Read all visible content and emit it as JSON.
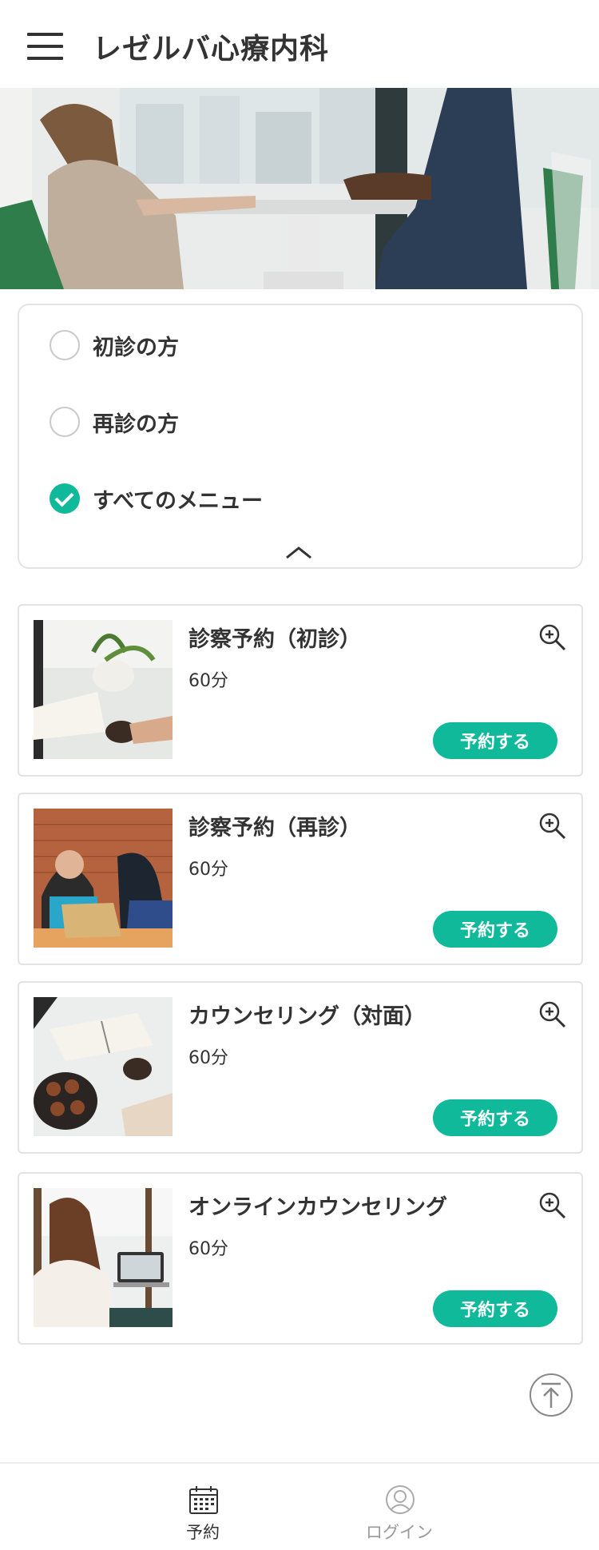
{
  "header": {
    "title": "レゼルバ心療内科",
    "menu_icon": "hamburger-icon"
  },
  "hero": {
    "image": "two-women-talking-at-table-photo"
  },
  "filter": {
    "options": [
      {
        "label": "初診の方",
        "checked": false
      },
      {
        "label": "再診の方",
        "checked": false
      },
      {
        "label": "すべてのメニュー",
        "checked": true
      }
    ],
    "collapse_icon": "chevron-up-icon"
  },
  "menus": [
    {
      "title": "診察予約（初診）",
      "duration": "60分",
      "button": "予約する",
      "thumbnail": "plant-and-book-photo",
      "zoom_icon": "zoom-in-icon"
    },
    {
      "title": "診察予約（再診）",
      "duration": "60分",
      "button": "予約する",
      "thumbnail": "women-with-laptop-photo",
      "zoom_icon": "zoom-in-icon"
    },
    {
      "title": "カウンセリング（対面）",
      "duration": "60分",
      "button": "予約する",
      "thumbnail": "book-and-cookies-photo",
      "zoom_icon": "zoom-in-icon"
    },
    {
      "title": "オンラインカウンセリング",
      "duration": "60分",
      "button": "予約する",
      "thumbnail": "woman-at-laptop-photo",
      "zoom_icon": "zoom-in-icon"
    }
  ],
  "back_to_top_icon": "arrow-up-circle-icon",
  "bottom_nav": {
    "reserve": {
      "label": "予約",
      "icon": "calendar-icon"
    },
    "login": {
      "label": "ログイン",
      "icon": "user-circle-icon"
    }
  },
  "colors": {
    "accent": "#10b99a",
    "text": "#333333",
    "border": "#e3e3e3",
    "muted": "#9a9a9a"
  }
}
